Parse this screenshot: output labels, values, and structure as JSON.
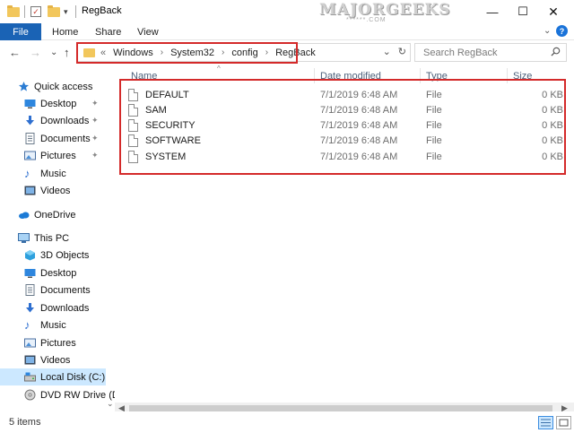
{
  "window": {
    "title": "RegBack",
    "watermark": {
      "main": "MAJORGEEKS",
      "sub": "******.COM"
    },
    "controls": [
      "minimize",
      "maximize",
      "close"
    ]
  },
  "ribbon": {
    "tabs": [
      "File",
      "Home",
      "Share",
      "View"
    ],
    "expand_glyph": "⌄",
    "help_glyph": "?"
  },
  "nav": {
    "back_glyph": "←",
    "forward_glyph": "→",
    "recent_glyph": "⌄",
    "up_glyph": "↑"
  },
  "address": {
    "overflow": "«",
    "crumbs": [
      "Windows",
      "System32",
      "config",
      "RegBack"
    ],
    "separator": "›",
    "dropdown_glyph": "⌄",
    "refresh_glyph": "↻"
  },
  "search": {
    "placeholder": "Search RegBack"
  },
  "sidebar": {
    "quick_access": "Quick access",
    "quick_items": [
      {
        "label": "Desktop",
        "icon": "desktop-icon",
        "pinned": true
      },
      {
        "label": "Downloads",
        "icon": "downloads-icon",
        "pinned": true
      },
      {
        "label": "Documents",
        "icon": "documents-icon",
        "pinned": true
      },
      {
        "label": "Pictures",
        "icon": "pictures-icon",
        "pinned": true
      },
      {
        "label": "Music",
        "icon": "music-icon",
        "pinned": false
      },
      {
        "label": "Videos",
        "icon": "videos-icon",
        "pinned": false
      }
    ],
    "pin_glyph": "📌",
    "onedrive": "OneDrive",
    "this_pc": "This PC",
    "pc_items": [
      {
        "label": "3D Objects",
        "icon": "3d-objects-icon"
      },
      {
        "label": "Desktop",
        "icon": "desktop-icon"
      },
      {
        "label": "Documents",
        "icon": "documents-icon"
      },
      {
        "label": "Downloads",
        "icon": "downloads-icon"
      },
      {
        "label": "Music",
        "icon": "music-icon"
      },
      {
        "label": "Pictures",
        "icon": "pictures-icon"
      },
      {
        "label": "Videos",
        "icon": "videos-icon"
      },
      {
        "label": "Local Disk (C:)",
        "icon": "local-disk-icon",
        "selected": true
      },
      {
        "label": "DVD RW Drive (D",
        "icon": "dvd-drive-icon"
      }
    ]
  },
  "columns": {
    "name": "Name",
    "date": "Date modified",
    "type": "Type",
    "size": "Size"
  },
  "files": [
    {
      "name": "DEFAULT",
      "date": "7/1/2019 6:48 AM",
      "type": "File",
      "size": "0 KB"
    },
    {
      "name": "SAM",
      "date": "7/1/2019 6:48 AM",
      "type": "File",
      "size": "0 KB"
    },
    {
      "name": "SECURITY",
      "date": "7/1/2019 6:48 AM",
      "type": "File",
      "size": "0 KB"
    },
    {
      "name": "SOFTWARE",
      "date": "7/1/2019 6:48 AM",
      "type": "File",
      "size": "0 KB"
    },
    {
      "name": "SYSTEM",
      "date": "7/1/2019 6:48 AM",
      "type": "File",
      "size": "0 KB"
    }
  ],
  "status": {
    "item_count": "5 items"
  },
  "colors": {
    "accent": "#1a63b5",
    "highlight": "#d42a2a",
    "selection": "#cce8ff"
  }
}
